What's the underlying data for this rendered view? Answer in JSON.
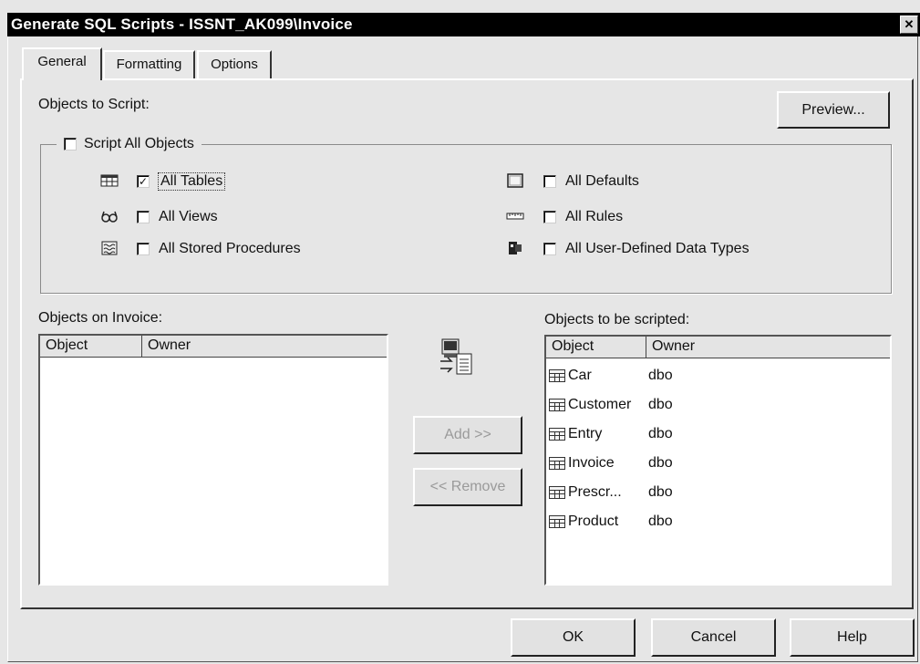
{
  "window": {
    "title": "Generate SQL Scripts - ISSNT_AK099\\Invoice",
    "close_glyph": "✕"
  },
  "tabs": [
    {
      "label": "General",
      "active": true
    },
    {
      "label": "Formatting"
    },
    {
      "label": "Options"
    }
  ],
  "objects_to_script": {
    "label": "Objects to Script:",
    "preview_label": "Preview...",
    "script_all": {
      "label": "Script All Objects",
      "checked": false
    },
    "options": [
      {
        "label": "All Tables",
        "checked": true,
        "icon": "table-icon"
      },
      {
        "label": "All Views",
        "checked": false,
        "icon": "view-icon"
      },
      {
        "label": "All Stored Procedures",
        "checked": false,
        "icon": "stored-procedure-icon"
      },
      {
        "label": "All Defaults",
        "checked": false,
        "icon": "default-icon"
      },
      {
        "label": "All Rules",
        "checked": false,
        "icon": "rule-icon"
      },
      {
        "label": "All User-Defined Data Types",
        "checked": false,
        "icon": "user-defined-type-icon"
      }
    ]
  },
  "left_list": {
    "label": "Objects on Invoice:",
    "columns": [
      "Object",
      "Owner"
    ],
    "rows": []
  },
  "right_list": {
    "label": "Objects to be scripted:",
    "columns": [
      "Object",
      "Owner"
    ],
    "rows": [
      {
        "object": "Car",
        "owner": "dbo"
      },
      {
        "object": "Customer",
        "owner": "dbo"
      },
      {
        "object": "Entry",
        "owner": "dbo"
      },
      {
        "object": "Invoice",
        "owner": "dbo"
      },
      {
        "object": "Prescr...",
        "owner": "dbo"
      },
      {
        "object": "Product",
        "owner": "dbo"
      }
    ]
  },
  "transfer": {
    "add_label": "Add >>",
    "remove_label": "<< Remove",
    "icon": "transfer-icon"
  },
  "footer": {
    "ok_label": "OK",
    "cancel_label": "Cancel",
    "help_label": "Help"
  },
  "check_glyph": "✓"
}
